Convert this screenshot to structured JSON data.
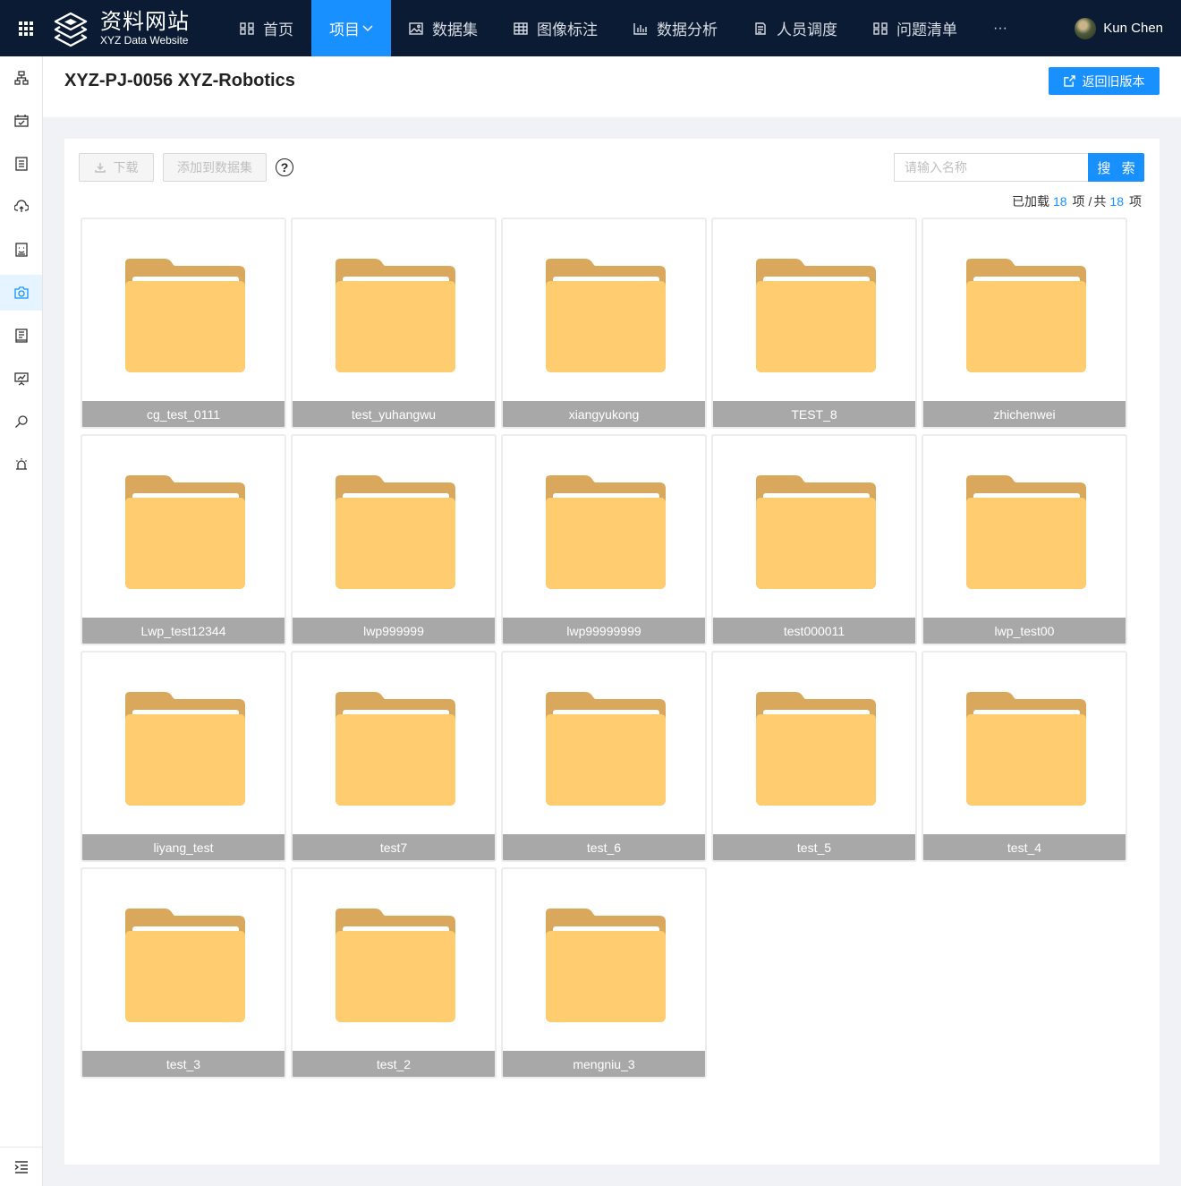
{
  "brand": {
    "title": "资料网站",
    "subtitle": "XYZ Data Website"
  },
  "nav": {
    "items": [
      {
        "label": "首页",
        "icon": "grid-icon"
      },
      {
        "label": "项目",
        "icon": "",
        "active": true
      },
      {
        "label": "数据集",
        "icon": "image-icon"
      },
      {
        "label": "图像标注",
        "icon": "table-icon"
      },
      {
        "label": "数据分析",
        "icon": "bar-chart-icon"
      },
      {
        "label": "人员调度",
        "icon": "document-icon"
      },
      {
        "label": "问题清单",
        "icon": "grid-icon"
      }
    ],
    "more": "···"
  },
  "user": {
    "name": "Kun Chen"
  },
  "sidebar": {
    "items": [
      {
        "icon": "sitemap-icon"
      },
      {
        "icon": "calendar-check-icon"
      },
      {
        "icon": "list-icon"
      },
      {
        "icon": "cloud-upload-icon"
      },
      {
        "icon": "monitor-face-icon"
      },
      {
        "icon": "camera-icon",
        "active": true
      },
      {
        "icon": "notes-icon"
      },
      {
        "icon": "presentation-chart-icon"
      },
      {
        "icon": "search-icon"
      },
      {
        "icon": "alarm-icon"
      }
    ],
    "collapse_icon": "indent-icon"
  },
  "page": {
    "title": "XYZ-PJ-0056 XYZ-Robotics",
    "legacy_button": "返回旧版本"
  },
  "toolbar": {
    "download_label": "下载",
    "add_to_dataset_label": "添加到数据集",
    "help": "?",
    "search_placeholder": "请输入名称",
    "search_button": "搜 索"
  },
  "counts": {
    "loaded_label": "已加载",
    "loaded": "18",
    "item_unit": "项",
    "separator": "/",
    "total_label": "共",
    "total": "18"
  },
  "folders": [
    "cg_test_0111",
    "test_yuhangwu",
    "xiangyukong",
    "TEST_8",
    "zhichenwei",
    "Lwp_test12344",
    "lwp999999",
    "lwp99999999",
    "test000011",
    "lwp_test00",
    "liyang_test",
    "test7",
    "test_6",
    "test_5",
    "test_4",
    "test_3",
    "test_2",
    "mengniu_3"
  ],
  "colors": {
    "accent": "#1890ff",
    "topbar": "#0b1b33",
    "folder_back": "#d9a85c",
    "folder_front": "#ffcd6f",
    "caption_bg": "#a8a8a8"
  }
}
